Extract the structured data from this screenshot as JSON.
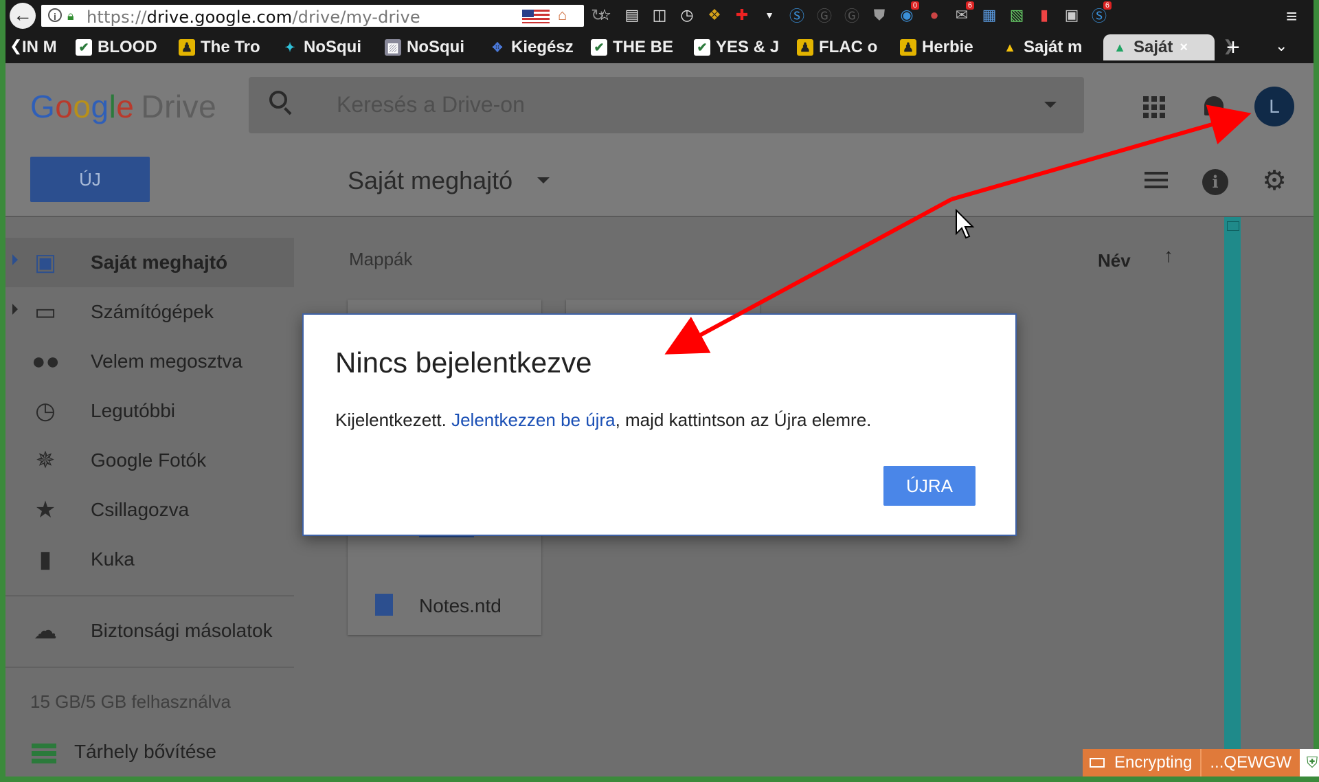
{
  "browser": {
    "url_prefix": "https://",
    "url_domain": "drive.google.com",
    "url_path": "/drive/my-drive",
    "extension_badges": {
      "ext_a": "0",
      "ext_b": "6",
      "ext_c": "6"
    },
    "tabs": [
      {
        "label": "IN M",
        "icon": "page-icon"
      },
      {
        "label": "BLOOD",
        "icon": "check-icon"
      },
      {
        "label": "The Tro",
        "icon": "figure-icon"
      },
      {
        "label": "NoSqui",
        "icon": "puzzle-icon"
      },
      {
        "label": "NoSqui",
        "icon": "image-icon"
      },
      {
        "label": "Kiegész",
        "icon": "puzzle-piece-icon"
      },
      {
        "label": "THE BE",
        "icon": "check-icon"
      },
      {
        "label": "YES & J",
        "icon": "check-icon"
      },
      {
        "label": "FLAC o",
        "icon": "figure-icon"
      },
      {
        "label": "Herbie",
        "icon": "figure-icon"
      },
      {
        "label": "Saját m",
        "icon": "drive-icon"
      },
      {
        "label": "Saját",
        "icon": "drive-icon",
        "active": true
      }
    ],
    "tab_close": "×",
    "new_tab": "+"
  },
  "header": {
    "logo_letters": [
      "G",
      "o",
      "o",
      "g",
      "l",
      "e"
    ],
    "logo_product": "Drive",
    "search_placeholder": "Keresés a Drive-on",
    "avatar_letter": "L"
  },
  "toolbar": {
    "new_button": "ÚJ",
    "breadcrumb": "Saját meghajtó"
  },
  "sidebar": {
    "items": [
      {
        "label": "Saját meghajtó",
        "icon": "drive-icon"
      },
      {
        "label": "Számítógépek",
        "icon": "computers-icon"
      },
      {
        "label": "Velem megosztva",
        "icon": "people-icon"
      },
      {
        "label": "Legutóbbi",
        "icon": "clock-icon"
      },
      {
        "label": "Google Fotók",
        "icon": "pinwheel-icon"
      },
      {
        "label": "Csillagozva",
        "icon": "star-icon"
      },
      {
        "label": "Kuka",
        "icon": "trash-icon"
      }
    ],
    "backups": "Biztonsági másolatok",
    "storage": "15 GB/5 GB felhasználva",
    "buy_storage": "Tárhely bővítése"
  },
  "main": {
    "section_folders": "Mappák",
    "sort_label": "Név",
    "file_name": "Notes.ntd"
  },
  "dialog": {
    "title": "Nincs bejelentkezve",
    "body_before": "Kijelentkezett. ",
    "body_link": "Jelentkezzen be újra",
    "body_after": ", majd kattintson az Újra elemre.",
    "retry": "ÚJRA"
  },
  "status": {
    "encrypting": "Encrypting",
    "key": "...QEWGW"
  },
  "colors": {
    "annotation_arrow": "#ff0000",
    "dialog_link": "#1a4fb5",
    "retry_button": "#4a86e8",
    "status_bar": "#e07a3a",
    "window_border": "#3b8a3b"
  }
}
